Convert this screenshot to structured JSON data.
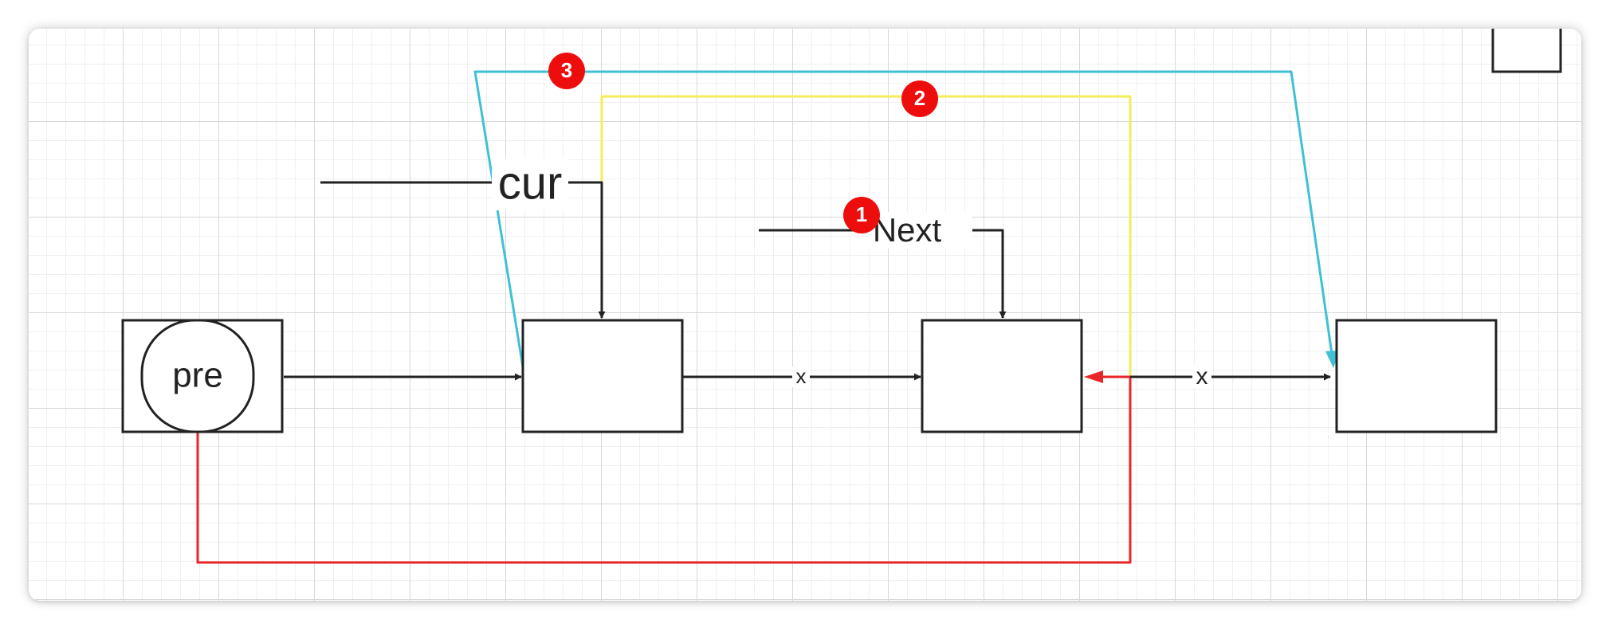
{
  "diagram": {
    "labels": {
      "pre": "pre",
      "cur": "cur",
      "next": "Next",
      "edge_mid_1": "x",
      "edge_mid_2": "x"
    },
    "badges": {
      "step_1": "1",
      "step_2": "2",
      "step_3": "3"
    },
    "colors": {
      "background": "#ffffff",
      "grid_minor": "#ececec",
      "grid_major": "#dcdcdc",
      "stroke": "#222222",
      "step_1_red": "#e8262a",
      "step_2_yellow": "#f3ee5a",
      "step_3_cyan": "#3fc1d3",
      "badge": "#ee0d0d"
    }
  }
}
